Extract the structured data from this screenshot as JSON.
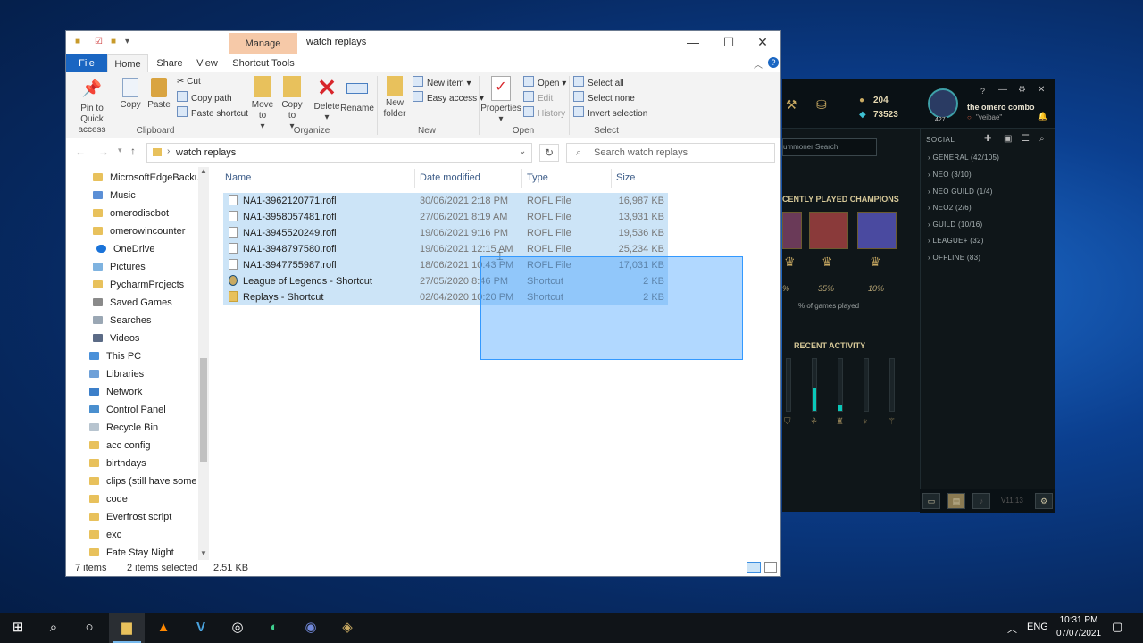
{
  "explorer": {
    "title": "watch replays",
    "manage_tab": "Manage",
    "tabs": [
      "File",
      "Home",
      "Share",
      "View",
      "Shortcut Tools"
    ],
    "ribbon": {
      "clipboard": {
        "group": "Clipboard",
        "pin": "Pin to Quick access",
        "copy": "Copy",
        "paste": "Paste",
        "cut": "Cut",
        "copy_path": "Copy path",
        "paste_shortcut": "Paste shortcut"
      },
      "organize": {
        "group": "Organize",
        "move_to": "Move to",
        "copy_to": "Copy to",
        "delete": "Delete",
        "rename": "Rename"
      },
      "new": {
        "group": "New",
        "new_folder": "New folder",
        "new_item": "New item",
        "easy_access": "Easy access"
      },
      "open": {
        "group": "Open",
        "properties": "Properties",
        "open": "Open",
        "edit": "Edit",
        "history": "History"
      },
      "select": {
        "group": "Select",
        "select_all": "Select all",
        "select_none": "Select none",
        "invert_selection": "Invert selection"
      }
    },
    "address": "watch replays",
    "search_placeholder": "Search watch replays",
    "nav_items": [
      "MicrosoftEdgeBackup",
      "Music",
      "omerodiscbot",
      "omerowincounter",
      "OneDrive",
      "Pictures",
      "PycharmProjects",
      "Saved Games",
      "Searches",
      "Videos",
      "This PC",
      "Libraries",
      "Network",
      "Control Panel",
      "Recycle Bin",
      "acc config",
      "birthdays",
      "clips (still have some cli",
      "code",
      "Everfrost script",
      "exc",
      "Fate Stay Night"
    ],
    "columns": {
      "name": "Name",
      "date": "Date modified",
      "type": "Type",
      "size": "Size"
    },
    "files": [
      {
        "name": "NA1-3962120771.rofl",
        "date": "30/06/2021 2:18 PM",
        "type": "ROFL File",
        "size": "16,987 KB"
      },
      {
        "name": "NA1-3958057481.rofl",
        "date": "27/06/2021 8:19 AM",
        "type": "ROFL File",
        "size": "13,931 KB"
      },
      {
        "name": "NA1-3945520249.rofl",
        "date": "19/06/2021 9:16 PM",
        "type": "ROFL File",
        "size": "19,536 KB"
      },
      {
        "name": "NA1-3948797580.rofl",
        "date": "19/06/2021 12:15 AM",
        "type": "ROFL File",
        "size": "25,234 KB"
      },
      {
        "name": "NA1-3947755987.rofl",
        "date": "18/06/2021 10:43 PM",
        "type": "ROFL File",
        "size": "17,031 KB"
      },
      {
        "name": "League of Legends - Shortcut",
        "date": "27/05/2020 8:46 PM",
        "type": "Shortcut",
        "size": "2 KB"
      },
      {
        "name": "Replays - Shortcut",
        "date": "02/04/2020 10:20 PM",
        "type": "Shortcut",
        "size": "2 KB"
      }
    ],
    "status": {
      "items": "7 items",
      "selected": "2 items selected",
      "size": "2.51 KB"
    }
  },
  "league": {
    "rp": "204",
    "be": "73523",
    "summoner": "the omero combo",
    "status": "\"veibae\"",
    "level": "427",
    "search_placeholder": "ummoner Search",
    "recent_champs_title": "CENTLY PLAYED CHAMPIONS",
    "percents": [
      "%",
      "35%",
      "10%"
    ],
    "games_label": "% of games played",
    "recent_activity": "RECENT ACTIVITY",
    "social_title": "SOCIAL",
    "social_groups": [
      "GENERAL (42/105)",
      "NEO (3/10)",
      "NEO GUILD (1/4)",
      "NEO2 (2/6)",
      "GUILD (10/16)",
      "LEAGUE+ (32)",
      "OFFLINE (83)"
    ],
    "version": "V11.13",
    "activity_levels": [
      0,
      0.45,
      0.1,
      0,
      0
    ]
  },
  "taskbar": {
    "language": "ENG",
    "time": "10:31 PM",
    "date": "07/07/2021"
  }
}
